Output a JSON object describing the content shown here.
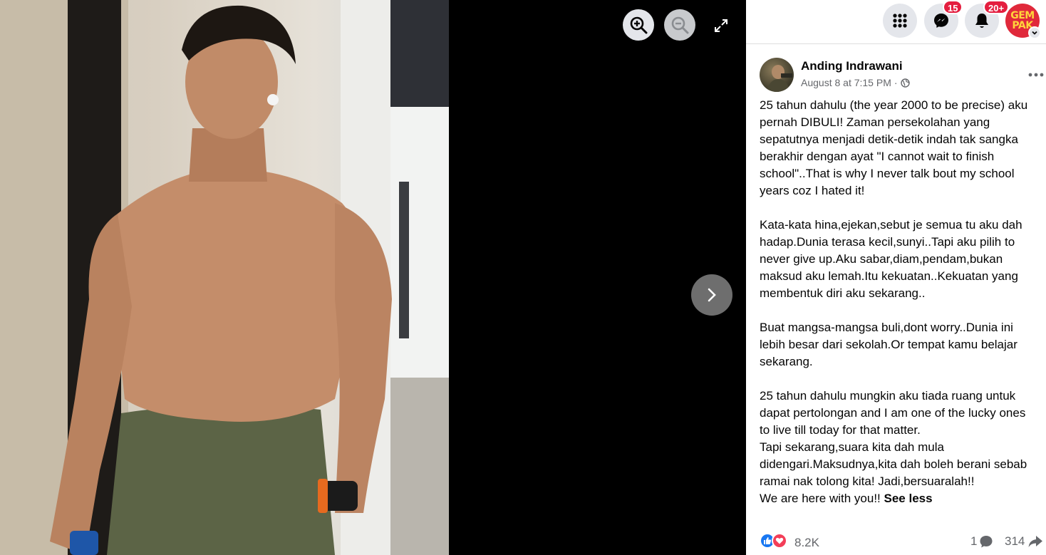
{
  "viewer": {
    "zoom_in_icon": "zoom-in-icon",
    "zoom_out_icon": "zoom-out-icon",
    "expand_icon": "expand-icon",
    "next_icon": "chevron-right-icon"
  },
  "topbar": {
    "menu_icon": "grid-menu-icon",
    "messenger_badge": "15",
    "notifications_badge": "20+",
    "profile_text_line1": "GEM",
    "profile_text_line2": "PAK"
  },
  "post": {
    "author": "Anding Indrawani",
    "timestamp": "August 8 at 7:15 PM",
    "separator": "·",
    "privacy_icon": "globe-icon",
    "text": "25 tahun dahulu (the year 2000 to be precise) aku pernah DIBULI! Zaman persekolahan yang sepatutnya menjadi detik-detik indah tak sangka berakhir dengan ayat \"I cannot wait to finish school\"..That is why I never talk bout my school years coz I hated it!\n\nKata-kata hina,ejekan,sebut je semua tu aku dah hadap.Dunia terasa kecil,sunyi..Tapi aku pilih to never give up.Aku sabar,diam,pendam,bukan maksud aku lemah.Itu kekuatan..Kekuatan yang membentuk diri aku sekarang..\n\nBuat mangsa-mangsa buli,dont worry..Dunia ini lebih besar dari sekolah.Or tempat kamu belajar sekarang.\n\n25 tahun dahulu mungkin aku tiada ruang untuk dapat pertolongan and I am one of the lucky ones to live till today for that matter.\nTapi sekarang,suara kita dah mula didengari.Maksudnya,kita dah boleh berani sebab ramai nak tolong kita! Jadi,bersuaralah!!\nWe are here with you!! ",
    "see_less": "See less",
    "reactions_count": "8.2K",
    "comments_count": "1",
    "shares_count": "314"
  },
  "colors": {
    "accent": "#1877f2",
    "badge": "#e41e3f",
    "love": "#f33e58",
    "secondary_text": "#65676b"
  }
}
